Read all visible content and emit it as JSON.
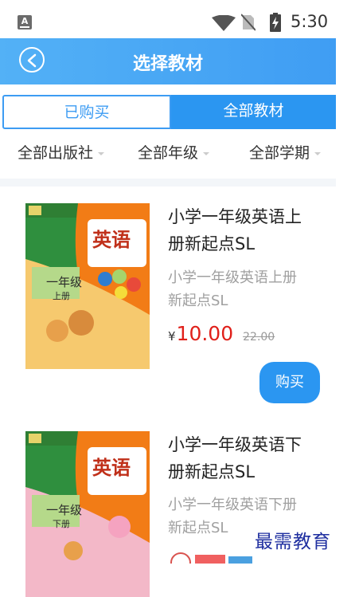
{
  "status_bar": {
    "app_icon_letter": "A",
    "time": "5:30",
    "icons": [
      "notification-icon",
      "wifi-icon",
      "no-sim-icon",
      "battery-charging-icon"
    ]
  },
  "header": {
    "title": "选择教材",
    "back_icon": "back-circle-icon",
    "gradient": [
      "#53b1f6",
      "#3f9df3"
    ]
  },
  "tabs": [
    {
      "label": "已购买",
      "active": false
    },
    {
      "label": "全部教材",
      "active": true
    }
  ],
  "filters": [
    {
      "label": "全部出版社"
    },
    {
      "label": "全部年级"
    },
    {
      "label": "全部学期"
    }
  ],
  "books": [
    {
      "title_line1": "小学一年级英语上",
      "title_line2": "册新起点SL",
      "desc_line1": "小学一年级英语上册",
      "desc_line2": "新起点SL",
      "currency": "¥",
      "price": "10.00",
      "original_price": "22.00",
      "buy_label": "购买",
      "cover": {
        "subject": "英语",
        "grade": "一年级",
        "volume": "上册"
      }
    },
    {
      "title_line1": "小学一年级英语下",
      "title_line2": "册新起点SL",
      "desc_line1": "小学一年级英语下册",
      "desc_line2": "新起点SL",
      "cover": {
        "subject": "英语",
        "grade": "一年级",
        "volume": "下册"
      }
    }
  ],
  "watermark": "最需教育",
  "colors": {
    "accent": "#2b96f1",
    "price_red": "#e0201a",
    "muted_text": "#a0a0a0",
    "watermark": "#1f2fa0"
  }
}
